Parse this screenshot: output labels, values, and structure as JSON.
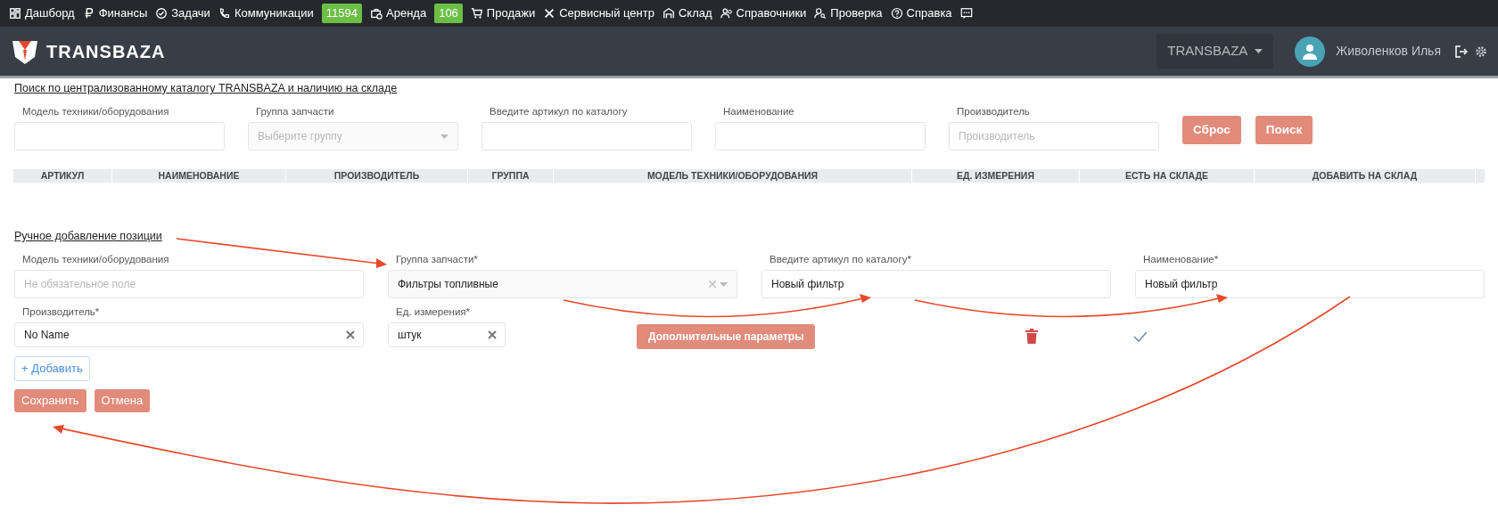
{
  "topnav": [
    {
      "label": "Дашборд"
    },
    {
      "label": "Финансы"
    },
    {
      "label": "Задачи"
    },
    {
      "label": "Коммуникации",
      "badge": "11594"
    },
    {
      "label": "Аренда",
      "badge": "106"
    },
    {
      "label": "Продажи"
    },
    {
      "label": "Сервисный центр"
    },
    {
      "label": "Склад"
    },
    {
      "label": "Справочники"
    },
    {
      "label": "Проверка"
    },
    {
      "label": "Справка"
    }
  ],
  "header": {
    "logo": "TRANSBAZA",
    "company": "TRANSBAZA",
    "user": "Живоленков Илья"
  },
  "search": {
    "title": "Поиск по централизованному каталогу TRANSBAZA и наличию на складе",
    "fields": [
      {
        "kind": "input",
        "label": "Модель техники/оборудования"
      },
      {
        "kind": "select",
        "label": "Группа запчасти",
        "placeholder": "Выберите группу"
      },
      {
        "kind": "input",
        "label": "Введите артикул по каталогу"
      },
      {
        "kind": "input",
        "label": "Наименование"
      },
      {
        "kind": "input",
        "label": "Производитель",
        "placeholder": "Производитель"
      }
    ],
    "buttons": [
      "Сброс",
      "Поиск"
    ]
  },
  "table": {
    "columns": [
      "АРТИКУЛ",
      "НАИМЕНОВАНИЕ",
      "ПРОИЗВОДИТЕЛЬ",
      "ГРУППА",
      "МОДЕЛЬ ТЕХНИКИ/ОБОРУДОВАНИЯ",
      "ЕД. ИЗМЕРЕНИЯ",
      "ЕСТЬ НА СКЛАДЕ",
      "ДОБАВИТЬ НА СКЛАД"
    ]
  },
  "manual": {
    "title": "Ручное добавление позиции",
    "fields": [
      {
        "kind": "input",
        "label": "Модель техники/оборудования",
        "placeholder": "Не обязательное поле"
      },
      {
        "kind": "select",
        "label": "Группа запчасти*",
        "value": "Фильтры топливные"
      },
      {
        "kind": "input",
        "label": "Введите артикул по каталогу*",
        "value": "Новый фильтр"
      },
      {
        "kind": "input",
        "label": "Наименование*",
        "value": "Новый фильтр"
      }
    ],
    "fields2": [
      {
        "kind": "clearable",
        "label": "Производитель*",
        "value": "No Name"
      },
      {
        "kind": "clearable",
        "label": "Ед. измерения*",
        "value": "штук"
      }
    ],
    "extra_button": "Дополнительные параметры",
    "add_button": "+ Добавить",
    "save_button": "Сохранить",
    "cancel_button": "Отмена"
  }
}
